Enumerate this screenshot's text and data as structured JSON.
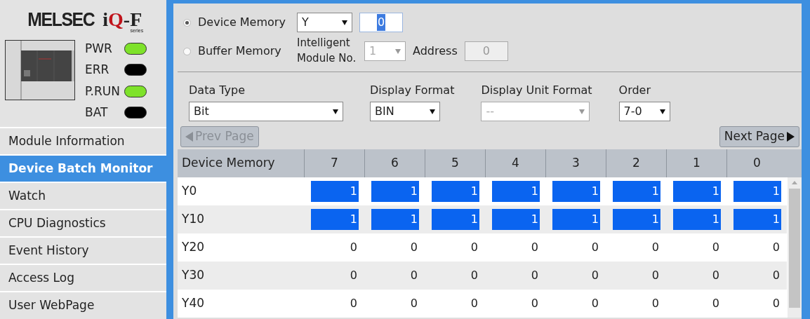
{
  "logo": {
    "brand": "MELSEC",
    "product": "iQ-F",
    "sub": "series"
  },
  "leds": [
    {
      "label": "PWR",
      "on": true
    },
    {
      "label": "ERR",
      "on": false
    },
    {
      "label": "P.RUN",
      "on": true
    },
    {
      "label": "BAT",
      "on": false
    }
  ],
  "sidebar": {
    "items": [
      {
        "label": "Module Information",
        "selected": false
      },
      {
        "label": "Device Batch Monitor",
        "selected": true
      },
      {
        "label": "Watch",
        "selected": false
      },
      {
        "label": "CPU Diagnostics",
        "selected": false
      },
      {
        "label": "Event History",
        "selected": false
      },
      {
        "label": "Access Log",
        "selected": false
      },
      {
        "label": "User WebPage",
        "selected": false
      }
    ]
  },
  "source": {
    "options": [
      {
        "label": "Device Memory",
        "selected": true
      },
      {
        "label": "Buffer Memory",
        "selected": false
      }
    ],
    "device_type": "Y",
    "device_number": "0",
    "module_label": "Intelligent Module No.",
    "module_no": "1",
    "address_label": "Address",
    "address": "0"
  },
  "settings": [
    {
      "label": "Data Type",
      "value": "Bit",
      "disabled": false
    },
    {
      "label": "Display Format",
      "value": "BIN",
      "disabled": false
    },
    {
      "label": "Display Unit Format",
      "value": "--",
      "disabled": true
    },
    {
      "label": "Order",
      "value": "7-0",
      "disabled": false
    }
  ],
  "pager": {
    "prev": {
      "label": "Prev Page",
      "disabled": true
    },
    "next": {
      "label": "Next Page",
      "disabled": false
    }
  },
  "table": {
    "columns": [
      "Device Memory",
      "7",
      "6",
      "5",
      "4",
      "3",
      "2",
      "1",
      "0"
    ],
    "rows": [
      {
        "label": "Y0",
        "bits": [
          {
            "value": "1",
            "on": true
          },
          {
            "value": "1",
            "on": true
          },
          {
            "value": "1",
            "on": true
          },
          {
            "value": "1",
            "on": true
          },
          {
            "value": "1",
            "on": true
          },
          {
            "value": "1",
            "on": true
          },
          {
            "value": "1",
            "on": true
          },
          {
            "value": "1",
            "on": true
          }
        ]
      },
      {
        "label": "Y10",
        "bits": [
          {
            "value": "1",
            "on": true
          },
          {
            "value": "1",
            "on": true
          },
          {
            "value": "1",
            "on": true
          },
          {
            "value": "1",
            "on": true
          },
          {
            "value": "1",
            "on": true
          },
          {
            "value": "1",
            "on": true
          },
          {
            "value": "1",
            "on": true
          },
          {
            "value": "1",
            "on": true
          }
        ]
      },
      {
        "label": "Y20",
        "bits": [
          {
            "value": "0",
            "on": false
          },
          {
            "value": "0",
            "on": false
          },
          {
            "value": "0",
            "on": false
          },
          {
            "value": "0",
            "on": false
          },
          {
            "value": "0",
            "on": false
          },
          {
            "value": "0",
            "on": false
          },
          {
            "value": "0",
            "on": false
          },
          {
            "value": "0",
            "on": false
          }
        ]
      },
      {
        "label": "Y30",
        "bits": [
          {
            "value": "0",
            "on": false
          },
          {
            "value": "0",
            "on": false
          },
          {
            "value": "0",
            "on": false
          },
          {
            "value": "0",
            "on": false
          },
          {
            "value": "0",
            "on": false
          },
          {
            "value": "0",
            "on": false
          },
          {
            "value": "0",
            "on": false
          },
          {
            "value": "0",
            "on": false
          }
        ]
      },
      {
        "label": "Y40",
        "bits": [
          {
            "value": "0",
            "on": false
          },
          {
            "value": "0",
            "on": false
          },
          {
            "value": "0",
            "on": false
          },
          {
            "value": "0",
            "on": false
          },
          {
            "value": "0",
            "on": false
          },
          {
            "value": "0",
            "on": false
          },
          {
            "value": "0",
            "on": false
          },
          {
            "value": "0",
            "on": false
          }
        ]
      }
    ]
  }
}
